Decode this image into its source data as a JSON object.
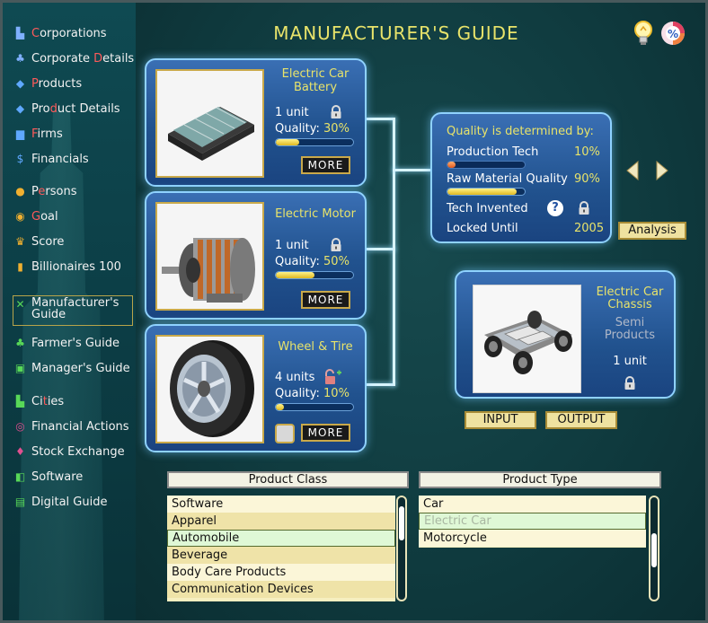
{
  "title": "MANUFACTURER'S GUIDE",
  "sidebar": {
    "items": [
      {
        "pre": "",
        "hl": "C",
        "post": "orporations",
        "icon": "building-icon",
        "color": "#7fb0ff"
      },
      {
        "pre": "Corporate ",
        "hl": "D",
        "post": "etails",
        "icon": "org-chart-icon",
        "color": "#7fb0ff"
      },
      {
        "pre": "",
        "hl": "P",
        "post": "roducts",
        "icon": "cube-icon",
        "color": "#5fa8ff"
      },
      {
        "pre": "Pro",
        "hl": "d",
        "post": "uct Details",
        "icon": "tag-icon",
        "color": "#5fa8ff"
      },
      {
        "pre": "",
        "hl": "F",
        "post": "irms",
        "icon": "factory-icon",
        "color": "#5fa8ff"
      },
      {
        "pre": "",
        "hl": "",
        "post": "Financials",
        "icon": "dollar-icon",
        "color": "#5fa8ff"
      },
      {
        "pre": "P",
        "hl": "e",
        "post": "rsons",
        "icon": "person-icon",
        "color": "#f0b030"
      },
      {
        "pre": "",
        "hl": "G",
        "post": "oal",
        "icon": "target-icon",
        "color": "#f0b030"
      },
      {
        "pre": "",
        "hl": "",
        "post": "Score",
        "icon": "trophy-icon",
        "color": "#f0b030"
      },
      {
        "pre": "",
        "hl": "",
        "post": "Billionaires 100",
        "icon": "bar-chart-icon",
        "color": "#f0b030"
      },
      {
        "pre": "",
        "hl": "",
        "post": "Manufacturer's Guide",
        "icon": "tools-icon",
        "color": "#58d858"
      },
      {
        "pre": "",
        "hl": "",
        "post": "Farmer's Guide",
        "icon": "plant-icon",
        "color": "#58d858"
      },
      {
        "pre": "",
        "hl": "",
        "post": "Manager's Guide",
        "icon": "briefcase-icon",
        "color": "#58d858"
      },
      {
        "pre": "Ci",
        "hl": "t",
        "post": "ies",
        "icon": "city-icon",
        "color": "#58d858"
      },
      {
        "pre": "",
        "hl": "",
        "post": "Financial Actions",
        "icon": "finance-icon",
        "color": "#e05090"
      },
      {
        "pre": "",
        "hl": "",
        "post": "Stock Exchange",
        "icon": "stock-icon",
        "color": "#e05090"
      },
      {
        "pre": "",
        "hl": "",
        "post": "Software",
        "icon": "code-icon",
        "color": "#58d858"
      },
      {
        "pre": "",
        "hl": "",
        "post": "Digital Guide",
        "icon": "book-icon",
        "color": "#58d858"
      }
    ]
  },
  "inputs": [
    {
      "name": "Electric Car Battery",
      "units": "1 unit",
      "quality_label": "Quality:",
      "quality": "30%",
      "quality_value": 30,
      "more": "MORE"
    },
    {
      "name": "Electric Motor",
      "units": "1 unit",
      "quality_label": "Quality:",
      "quality": "50%",
      "quality_value": 50,
      "more": "MORE"
    },
    {
      "name": "Wheel & Tire",
      "units": "4 units",
      "quality_label": "Quality:",
      "quality": "10%",
      "quality_value": 10,
      "more": "MORE"
    }
  ],
  "quality_panel": {
    "heading": "Quality is determined by:",
    "production_tech_label": "Production Tech",
    "production_tech_value": "10%",
    "production_tech_level": 10,
    "raw_material_label": "Raw Material Quality",
    "raw_material_value": "90%",
    "raw_material_level": 90,
    "tech_invented_label": "Tech Invented",
    "locked_until_label": "Locked Until",
    "locked_until_value": "2005"
  },
  "analysis_button": "Analysis",
  "output_product": {
    "name": "Electric Car Chassis",
    "category": "Semi Products",
    "units": "1 unit"
  },
  "input_button": "INPUT",
  "output_button": "OUTPUT",
  "product_class": {
    "header": "Product Class",
    "items": [
      "Software",
      "Apparel",
      "Automobile",
      "Beverage",
      "Body Care Products",
      "Communication Devices"
    ],
    "selected": "Automobile"
  },
  "product_type": {
    "header": "Product Type",
    "items": [
      "Car",
      "Electric Car",
      "Motorcycle"
    ],
    "selected": "Electric Car"
  }
}
